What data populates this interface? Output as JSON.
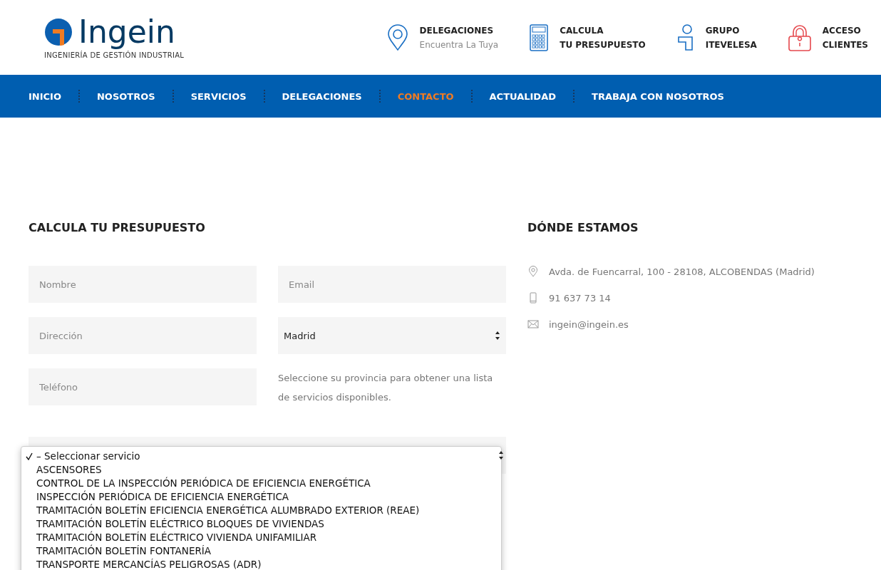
{
  "header": {
    "logo": {
      "name": "Ingein",
      "tagline": "INGENIERÍA DE GESTIÓN INDUSTRIAL"
    },
    "links": [
      {
        "kind": "pin",
        "title": "DELEGACIONES",
        "subtitle": "Encuentra La Tuya"
      },
      {
        "kind": "calculator",
        "title": "CALCULA",
        "subtitle": "TU PRESUPUESTO"
      },
      {
        "kind": "group",
        "title": "GRUPO",
        "subtitle": "ITEVELESA"
      },
      {
        "kind": "lock",
        "title": "ACCESO",
        "subtitle": "CLIENTES"
      }
    ]
  },
  "nav": [
    {
      "label": "INICIO",
      "selected": false
    },
    {
      "label": "NOSOTROS",
      "selected": false
    },
    {
      "label": "SERVICIOS",
      "selected": false
    },
    {
      "label": "DELEGACIONES",
      "selected": false
    },
    {
      "label": "CONTACTO",
      "selected": true
    },
    {
      "label": "ACTUALIDAD",
      "selected": false
    },
    {
      "label": "TRABAJA CON NOSOTROS",
      "selected": false
    }
  ],
  "form": {
    "title": "CALCULA TU PRESUPUESTO",
    "fields": [
      {
        "kind": "input",
        "placeholder": "Nombre"
      },
      {
        "kind": "input",
        "placeholder": "Email"
      },
      {
        "kind": "input",
        "placeholder": "Dirección"
      },
      {
        "kind": "select",
        "value": "Madrid"
      },
      {
        "kind": "input",
        "placeholder": "Teléfono"
      },
      {
        "kind": "note",
        "text": "Seleccione su provincia para obtener una lista de servicios disponibles."
      }
    ],
    "service_options": [
      {
        "label": "– Seleccionar servicio",
        "selected": true
      },
      {
        "label": "ASCENSORES",
        "selected": false
      },
      {
        "label": "CONTROL DE LA INSPECCIÓN PERIÓDICA DE EFICIENCIA ENERGÉTICA",
        "selected": false
      },
      {
        "label": "INSPECCIÓN PERIÓDICA DE EFICIENCIA ENERGÉTICA",
        "selected": false
      },
      {
        "label": "TRAMITACIÓN BOLETÍN EFICIENCIA ENERGÉTICA ALUMBRADO EXTERIOR (REAE)",
        "selected": false
      },
      {
        "label": "TRAMITACIÓN BOLETÍN ELÉCTRICO BLOQUES DE VIVIENDAS",
        "selected": false
      },
      {
        "label": "TRAMITACIÓN BOLETÍN ELÉCTRICO VIVIENDA UNIFAMILIAR",
        "selected": false
      },
      {
        "label": "TRAMITACIÓN BOLETÍN FONTANERÍA",
        "selected": false
      },
      {
        "label": "TRANSPORTE MERCANCÍAS PELIGROSAS (ADR)",
        "selected": false
      }
    ]
  },
  "contact": {
    "title": "DÓNDE ESTAMOS",
    "items": [
      {
        "kind": "pin",
        "text": "Avda. de Fuencarral, 100 - 28108, ALCOBENDAS (Madrid)"
      },
      {
        "kind": "phone",
        "text": "91 637 73 14"
      },
      {
        "kind": "mail",
        "text": "ingein@ingein.es"
      }
    ]
  }
}
